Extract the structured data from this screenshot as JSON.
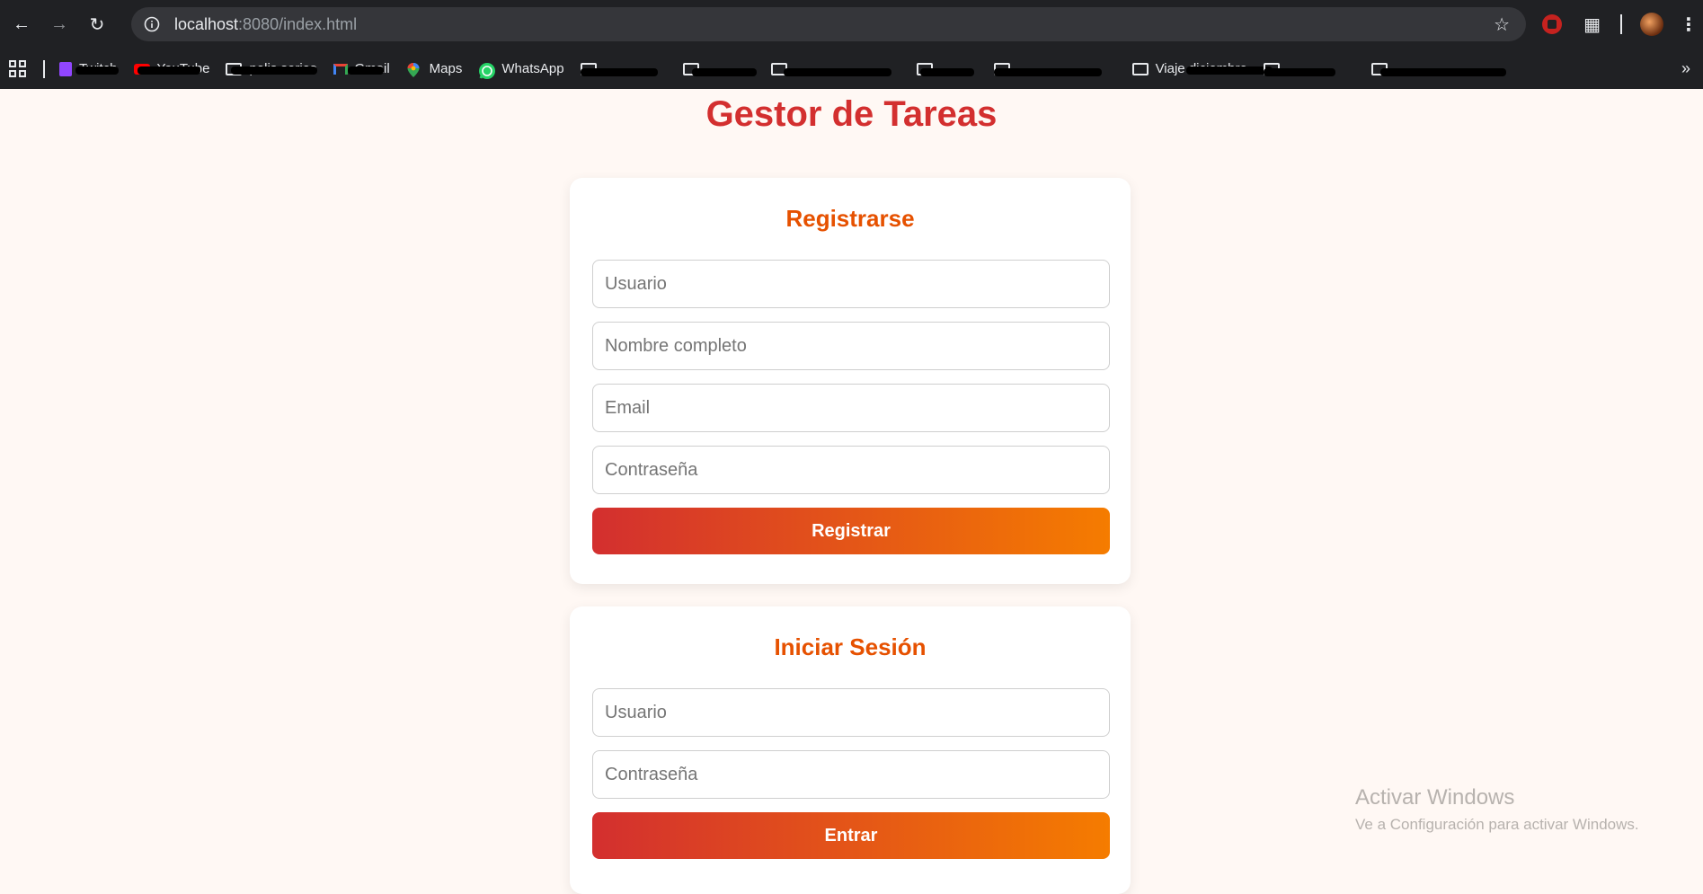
{
  "browser": {
    "url_host": "localhost",
    "url_path": ":8080/index.html",
    "bookmarks": [
      {
        "label": "Twitch",
        "icon": "twitch-icon",
        "redacted": true
      },
      {
        "label": "YouTube",
        "icon": "youtube-icon",
        "redacted": true
      },
      {
        "label": "pelis series",
        "icon": "folder-icon",
        "redacted": true
      },
      {
        "label": "Gmail",
        "icon": "gmail-icon",
        "redacted": true
      },
      {
        "label": "Maps",
        "icon": "maps-icon",
        "redacted": false
      },
      {
        "label": "WhatsApp",
        "icon": "whatsapp-icon",
        "redacted": false
      },
      {
        "label": "",
        "icon": "folder-icon",
        "redacted": true
      },
      {
        "label": "",
        "icon": "folder-icon",
        "redacted": true
      },
      {
        "label": "",
        "icon": "folder-icon",
        "redacted": true
      },
      {
        "label": "",
        "icon": "folder-icon",
        "redacted": true
      },
      {
        "label": "",
        "icon": "folder-icon",
        "redacted": true
      },
      {
        "label": "Viaje diciembre",
        "icon": "folder-icon",
        "redacted": true
      },
      {
        "label": "",
        "icon": "folder-icon",
        "redacted": true
      },
      {
        "label": "",
        "icon": "folder-icon",
        "redacted": true
      }
    ]
  },
  "page": {
    "title": "Gestor de Tareas"
  },
  "register": {
    "heading": "Registrarse",
    "username_placeholder": "Usuario",
    "fullname_placeholder": "Nombre completo",
    "email_placeholder": "Email",
    "password_placeholder": "Contraseña",
    "submit_label": "Registrar"
  },
  "login": {
    "heading": "Iniciar Sesión",
    "username_placeholder": "Usuario",
    "password_placeholder": "Contraseña",
    "submit_label": "Entrar"
  },
  "watermark": {
    "line1": "Activar Windows",
    "line2": "Ve a Configuración para activar Windows."
  },
  "colors": {
    "title": "#d32f2f",
    "heading": "#e65100",
    "button_start": "#d32f2f",
    "button_end": "#f57c00",
    "background": "#fff8f4"
  }
}
